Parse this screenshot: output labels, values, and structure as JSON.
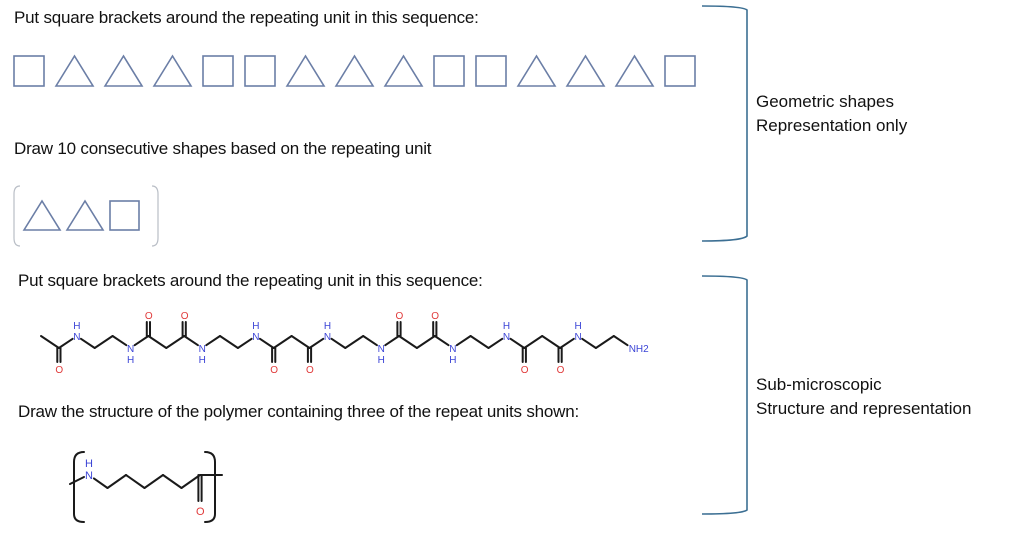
{
  "section_geometric": {
    "prompt_1": "Put square brackets around the repeating unit in this sequence:",
    "sequence": [
      "square",
      "triangle",
      "triangle",
      "triangle",
      "square",
      "square",
      "triangle",
      "triangle",
      "triangle",
      "square",
      "square",
      "triangle",
      "triangle",
      "triangle",
      "square"
    ],
    "prompt_2": "Draw 10 consecutive shapes based on the repeating unit",
    "repeat_unit": [
      "triangle",
      "triangle",
      "square"
    ],
    "category_line_1": "Geometric shapes",
    "category_line_2": "Representation only"
  },
  "section_molecular": {
    "prompt_1": "Put square brackets around the repeating unit in this sequence:",
    "chain_atoms": [
      "CH3",
      "C=O",
      "NH",
      "C",
      "C",
      "NH",
      "C=O",
      "C",
      "C=O",
      "NH",
      "C",
      "C",
      "NH",
      "C=O",
      "C",
      "C=O",
      "NH",
      "C",
      "C",
      "NH",
      "C=O",
      "C",
      "C=O",
      "NH",
      "C",
      "C",
      "NH",
      "C=O",
      "C",
      "C=O",
      "NH",
      "C",
      "C",
      "NH2"
    ],
    "terminal_label": "NH2",
    "prompt_2": "Draw the structure of the polymer containing three of the repeat units shown:",
    "repeat_unit_atoms": [
      "NH",
      "C",
      "C",
      "C",
      "C",
      "C",
      "C=O"
    ],
    "category_line_1": "Sub-microscopic",
    "category_line_2": "Structure and representation"
  },
  "atom_labels": {
    "nitrogen": "N",
    "hydrogen": "H",
    "oxygen": "O"
  },
  "colors": {
    "shape_stroke": "#6b7ea6",
    "nitrogen": "#3b44d6",
    "oxygen": "#e03a3a",
    "brace": "#3c6f93"
  }
}
